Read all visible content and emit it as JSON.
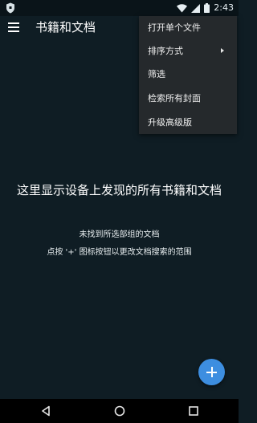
{
  "status_bar": {
    "time": "2:43"
  },
  "app_bar": {
    "title": "书籍和文档"
  },
  "overflow_menu": {
    "items": [
      {
        "label": "打开单个文件"
      },
      {
        "label": "排序方式",
        "has_submenu": true
      },
      {
        "label": "筛选"
      },
      {
        "label": "检索所有封面"
      },
      {
        "label": "升级高级版"
      }
    ]
  },
  "empty_state": {
    "title": "这里显示设备上发现的所有书籍和文档",
    "line1": "未找到所选部组的文档",
    "line2": "点按 '+' 图标按钮以更改文档搜索的范围"
  },
  "colors": {
    "background": "#0f1d24",
    "menu_background": "#25292c",
    "fab": "#3d8ee0"
  },
  "icons": {
    "status_left": "shield-icon",
    "wifi": "wifi-icon",
    "signal": "signal-icon",
    "battery": "battery-icon",
    "menu": "hamburger-menu-icon",
    "fab": "plus-icon",
    "nav_back": "back-icon",
    "nav_home": "home-icon",
    "nav_recents": "recents-icon"
  }
}
